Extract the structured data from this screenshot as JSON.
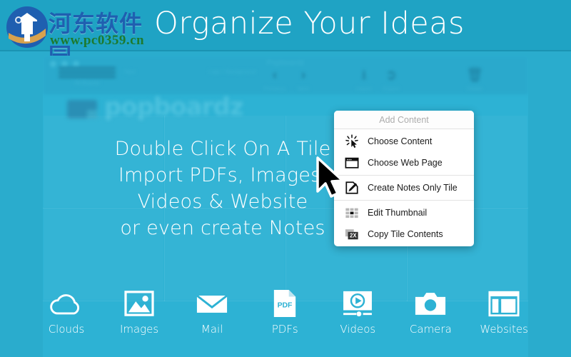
{
  "banner": {
    "headline": "Organize Your Ideas",
    "watermark_cn": "河东软件园",
    "watermark_url": "www.pc0359.cn"
  },
  "app_window": {
    "title": "Popboardz",
    "brand": "popboardz",
    "toolbar": [
      {
        "label": "All Boards",
        "icon": "lines-icon"
      },
      {
        "label": "New",
        "icon": "new-tile-icon"
      },
      {
        "label": "Logo / Background",
        "icon": "logo-background-icon"
      },
      {
        "label": "Previous",
        "icon": "chevron-left-icon"
      },
      {
        "label": "Next",
        "icon": "chevron-right-icon"
      },
      {
        "label": "Import",
        "icon": "import-icon"
      },
      {
        "label": "Export",
        "icon": "export-icon"
      },
      {
        "label": "Delete",
        "icon": "trash-icon"
      }
    ]
  },
  "hero": {
    "lines": [
      "Double Click On A Tile",
      "Import PDFs, Images,",
      "Videos & Website",
      "or even create Notes"
    ]
  },
  "context_menu": {
    "header": "Add Content",
    "groups": [
      {
        "items": [
          {
            "label": "Choose Content",
            "icon": "click-burst-icon"
          },
          {
            "label": "Choose Web Page",
            "icon": "browser-window-icon"
          }
        ]
      },
      {
        "items": [
          {
            "label": "Create Notes Only Tile",
            "icon": "pencil-note-icon"
          }
        ]
      },
      {
        "items": [
          {
            "label": "Edit Thumbnail",
            "icon": "thumbnail-grid-icon"
          },
          {
            "label": "Copy Tile Contents",
            "icon": "two-x-icon",
            "badge": "2X"
          }
        ]
      }
    ]
  },
  "bottom_row": {
    "items": [
      {
        "label": "Clouds",
        "icon": "cloud-icon"
      },
      {
        "label": "Images",
        "icon": "image-icon"
      },
      {
        "label": "Mail",
        "icon": "envelope-icon"
      },
      {
        "label": "PDFs",
        "icon": "pdf-file-icon",
        "badge": "PDF"
      },
      {
        "label": "Videos",
        "icon": "video-player-icon"
      },
      {
        "label": "Camera",
        "icon": "camera-icon"
      },
      {
        "label": "Websites",
        "icon": "website-window-icon"
      }
    ]
  },
  "colors": {
    "banner_bg": "#1fa3c4",
    "canvas_bg": "#2db2d4",
    "menu_bg": "#ffffff",
    "menu_header_text": "#adadad",
    "white": "#ffffff",
    "watermark_blue": "#1f5fb0",
    "watermark_green": "#1d7a2e"
  }
}
